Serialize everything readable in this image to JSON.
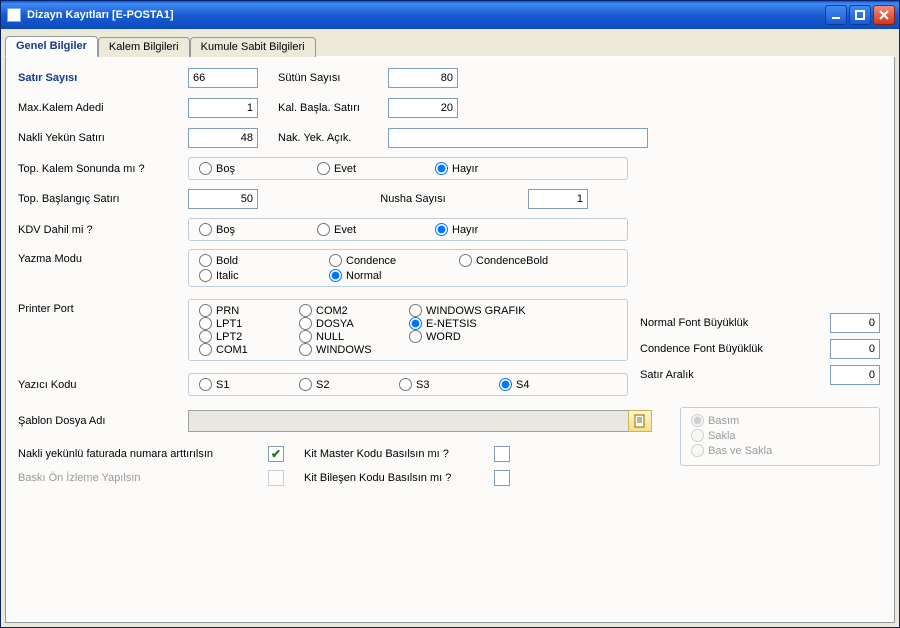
{
  "window": {
    "title": "Dizayn Kayıtları [E-POSTA1]"
  },
  "tabs": {
    "t0": "Genel Bilgiler",
    "t1": "Kalem Bilgileri",
    "t2": "Kumule Sabit Bilgileri"
  },
  "labels": {
    "satir_sayisi": "Satır Sayısı",
    "sutun_sayisi": "Sütün Sayısı",
    "max_kalem_adedi": "Max.Kalem Adedi",
    "kal_basla_satiri": "Kal. Başla. Satırı",
    "nakli_yekun_satiri": "Nakli Yekün Satırı",
    "nak_yek_acik": "Nak. Yek. Açık.",
    "top_kalem_sonunda": "Top. Kalem Sonunda mı ?",
    "top_baslangic_satiri": "Top. Başlangıç Satırı",
    "nusha_sayisi": "Nusha Sayısı",
    "kdv_dahil": "KDV Dahil mi ?",
    "yazma_modu": "Yazma Modu",
    "printer_port": "Printer Port",
    "yazici_kodu": "Yazıcı Kodu",
    "sablon_dosya_adi": "Şablon Dosya Adı",
    "nakli_fatura": "Nakli yekünlü faturada numara arttırılsın",
    "baski_on_izleme": "Baskı Ön İzleme Yapılsın",
    "kit_master": "Kit Master Kodu Basılsın mı ?",
    "kit_bilesen": "Kit Bileşen Kodu Basılsın mı ?",
    "normal_font": "Normal Font Büyüklük",
    "condence_font": "Condence Font Büyüklük",
    "satir_aralik": "Satır Aralık"
  },
  "values": {
    "satir_sayisi": "66",
    "sutun_sayisi": "80",
    "max_kalem_adedi": "1",
    "kal_basla_satiri": "20",
    "nakli_yekun_satiri": "48",
    "nak_yek_acik": "",
    "top_baslangic_satiri": "50",
    "nusha_sayisi": "1",
    "normal_font": "0",
    "condence_font": "0",
    "satir_aralik": "0",
    "sablon": ""
  },
  "options": {
    "bos": "Boş",
    "evet": "Evet",
    "hayir": "Hayır",
    "bold": "Bold",
    "condence": "Condence",
    "condencebold": "CondenceBold",
    "italic": "Italic",
    "normal": "Normal",
    "prn": "PRN",
    "lpt1": "LPT1",
    "lpt2": "LPT2",
    "com1": "COM1",
    "com2": "COM2",
    "dosya": "DOSYA",
    "null": "NULL",
    "windows": "WINDOWS",
    "windows_grafik": "WINDOWS GRAFIK",
    "enetsis": "E-NETSIS",
    "word": "WORD",
    "s1": "S1",
    "s2": "S2",
    "s3": "S3",
    "s4": "S4",
    "basim": "Basım",
    "sakla": "Sakla",
    "bas_ve_sakla": "Bas ve Sakla"
  }
}
